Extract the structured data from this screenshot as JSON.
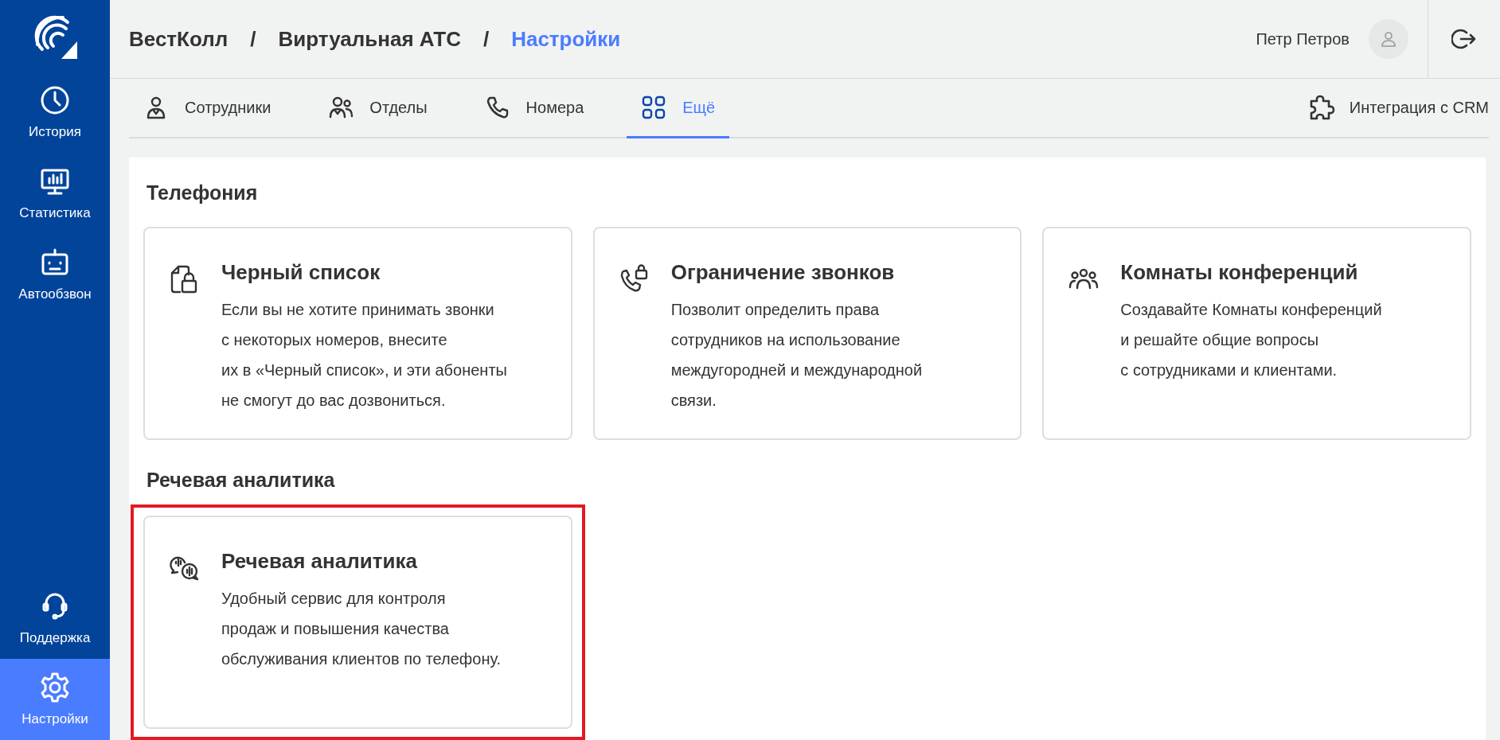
{
  "sidebar": {
    "items": [
      {
        "kind": "history",
        "label": "История",
        "selected": false
      },
      {
        "kind": "stats",
        "label": "Статистика",
        "selected": false
      },
      {
        "kind": "robot",
        "label": "Автообзвон",
        "selected": false
      }
    ],
    "bottom_items": [
      {
        "kind": "support",
        "label": "Поддержка",
        "selected": false
      },
      {
        "kind": "settings",
        "label": "Настройки",
        "selected": true
      }
    ]
  },
  "breadcrumbs": [
    {
      "label": "ВестКолл",
      "selected": false
    },
    {
      "separator": "/",
      "label": "Виртуальная АТС",
      "selected": false
    },
    {
      "separator": "/",
      "label": "Настройки",
      "selected": true
    }
  ],
  "user": {
    "name": "Петр Петров"
  },
  "tabs": [
    {
      "kind": "person",
      "label": "Сотрудники",
      "selected": false
    },
    {
      "kind": "group",
      "label": "Отделы",
      "selected": false
    },
    {
      "kind": "phone",
      "label": "Номера",
      "selected": false
    },
    {
      "kind": "grid",
      "label": "Ещё",
      "selected": true
    }
  ],
  "crm_link": {
    "label": "Интеграция с CRM"
  },
  "sections": [
    {
      "title": "Телефония",
      "cards": [
        {
          "kind": "lock",
          "title": "Черный список",
          "text": "Если вы не хотите принимать звонки\nс некоторых номеров, внесите\nих в «Черный список», и эти абоненты\nне смогут до вас дозвониться.",
          "highlighted": false
        },
        {
          "kind": "phonelock",
          "title": "Ограничение звонков",
          "text": "Позволит определить права\nсотрудников на использование\nмеждугородней и международной\nсвязи.",
          "highlighted": false
        },
        {
          "kind": "people",
          "title": "Комнаты конференций",
          "text": "Создавайте Комнаты конференций\nи решайте общие вопросы\nс сотрудниками и клиентами.",
          "highlighted": false
        }
      ]
    },
    {
      "title": "Речевая аналитика",
      "cards": [
        {
          "kind": "speech",
          "title": "Речевая аналитика",
          "text": "Удобный сервис для контроля\nпродаж и повышения качества\nобслуживания клиентов по телефону.",
          "highlighted": true
        }
      ]
    }
  ]
}
